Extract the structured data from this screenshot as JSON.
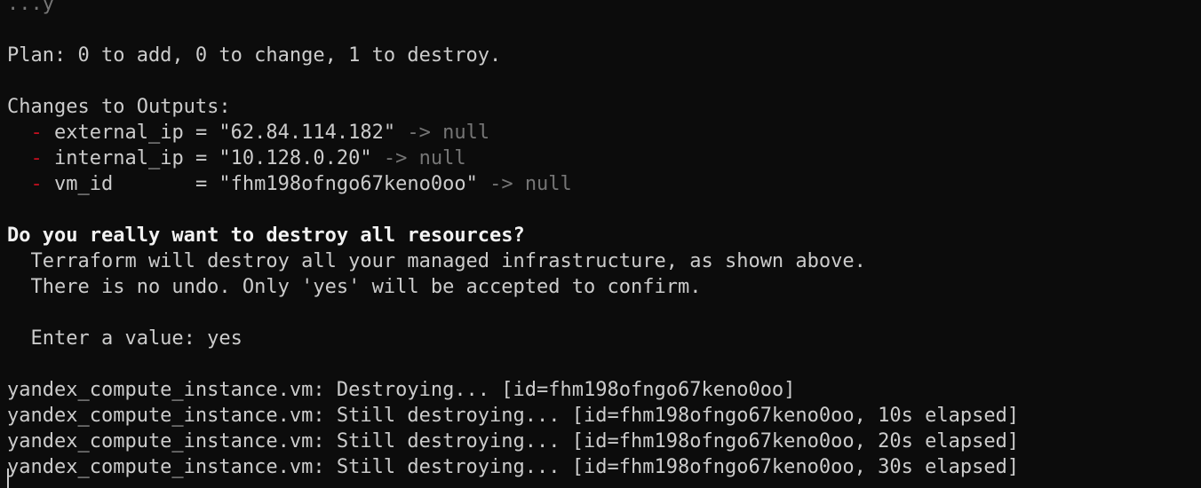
{
  "colors": {
    "background": "#0c0c0c",
    "text": "#cccccc",
    "bold_text": "#f2f2f2",
    "delete_marker": "#c50f1f",
    "null_value": "#767676"
  },
  "lines": {
    "l0": "...y",
    "plan": "Plan: 0 to add, 0 to change, 1 to destroy.",
    "outputs_header": "Changes to Outputs:",
    "out1": {
      "marker": "-",
      "key": "external_ip = \"62.84.114.182\" ",
      "tail": "-> null"
    },
    "out2": {
      "marker": "-",
      "key": "internal_ip = \"10.128.0.20\" ",
      "tail": "-> null"
    },
    "out3": {
      "marker": "-",
      "key": "vm_id       = \"fhm198ofngo67keno0oo\" ",
      "tail": "-> null"
    },
    "confirm_q": "Do you really want to destroy all resources?",
    "confirm_1": "  Terraform will destroy all your managed infrastructure, as shown above.",
    "confirm_2": "  There is no undo. Only 'yes' will be accepted to confirm.",
    "prompt": "  Enter a value: yes",
    "d1": "yandex_compute_instance.vm: Destroying... [id=fhm198ofngo67keno0oo]",
    "d2": "yandex_compute_instance.vm: Still destroying... [id=fhm198ofngo67keno0oo, 10s elapsed]",
    "d3": "yandex_compute_instance.vm: Still destroying... [id=fhm198ofngo67keno0oo, 20s elapsed]",
    "d4": "yandex_compute_instance.vm: Still destroying... [id=fhm198ofngo67keno0oo, 30s elapsed]"
  }
}
